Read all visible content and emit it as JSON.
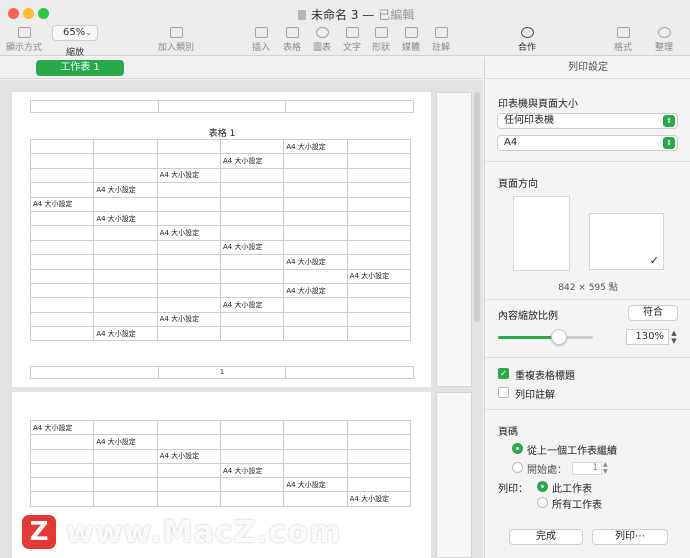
{
  "window": {
    "title": "未命名 3",
    "separator": "—",
    "status": "已編輯"
  },
  "toolbar": {
    "view_label": "顯示方式",
    "zoom_value": "65%",
    "zoom_label": "縮放",
    "add_category_label": "加入類別",
    "insert_label": "插入",
    "table_label": "表格",
    "chart_label": "圖表",
    "text_label": "文字",
    "shape_label": "形狀",
    "media_label": "媒體",
    "comment_label": "註解",
    "collaborate_label": "合作",
    "format_label": "格式",
    "organize_label": "整理"
  },
  "sheet_tab": "工作表 1",
  "document": {
    "table_title": "表格 1",
    "cell_text": "A4 大小設定",
    "page_number": "1",
    "page1_rows": [
      4,
      3,
      2,
      1,
      0,
      1,
      2,
      3,
      4,
      5,
      4,
      3,
      2,
      1
    ],
    "page2_rows": [
      0,
      1,
      2,
      3,
      4,
      5
    ]
  },
  "panel": {
    "title": "列印設定",
    "printer_section": "印表機與頁面大小",
    "printer": "任何印表機",
    "paper_size": "A4",
    "orientation_section": "頁面方向",
    "dimensions": "842 × 595 點",
    "scale_section": "內容縮放比例",
    "fit_button": "符合",
    "scale_percent": 0.3,
    "scale_value": "130%",
    "repeat_headers": "重複表格標題",
    "print_comments": "列印註解",
    "page_numbers_section": "頁碼",
    "continue_from_previous": "從上一個工作表繼續",
    "start_at": "開始處：",
    "start_value": "1",
    "print_label": "列印：",
    "this_sheet": "此工作表",
    "all_sheets": "所有工作表",
    "done_button": "完成",
    "print_button": "列印⋯"
  },
  "watermark": {
    "logo": "Z",
    "text": "www.MacZ.com"
  },
  "colors": {
    "accent": "#2aa84c",
    "close": "#fe5f57",
    "minimize": "#febc2e",
    "zoom": "#28c840"
  }
}
